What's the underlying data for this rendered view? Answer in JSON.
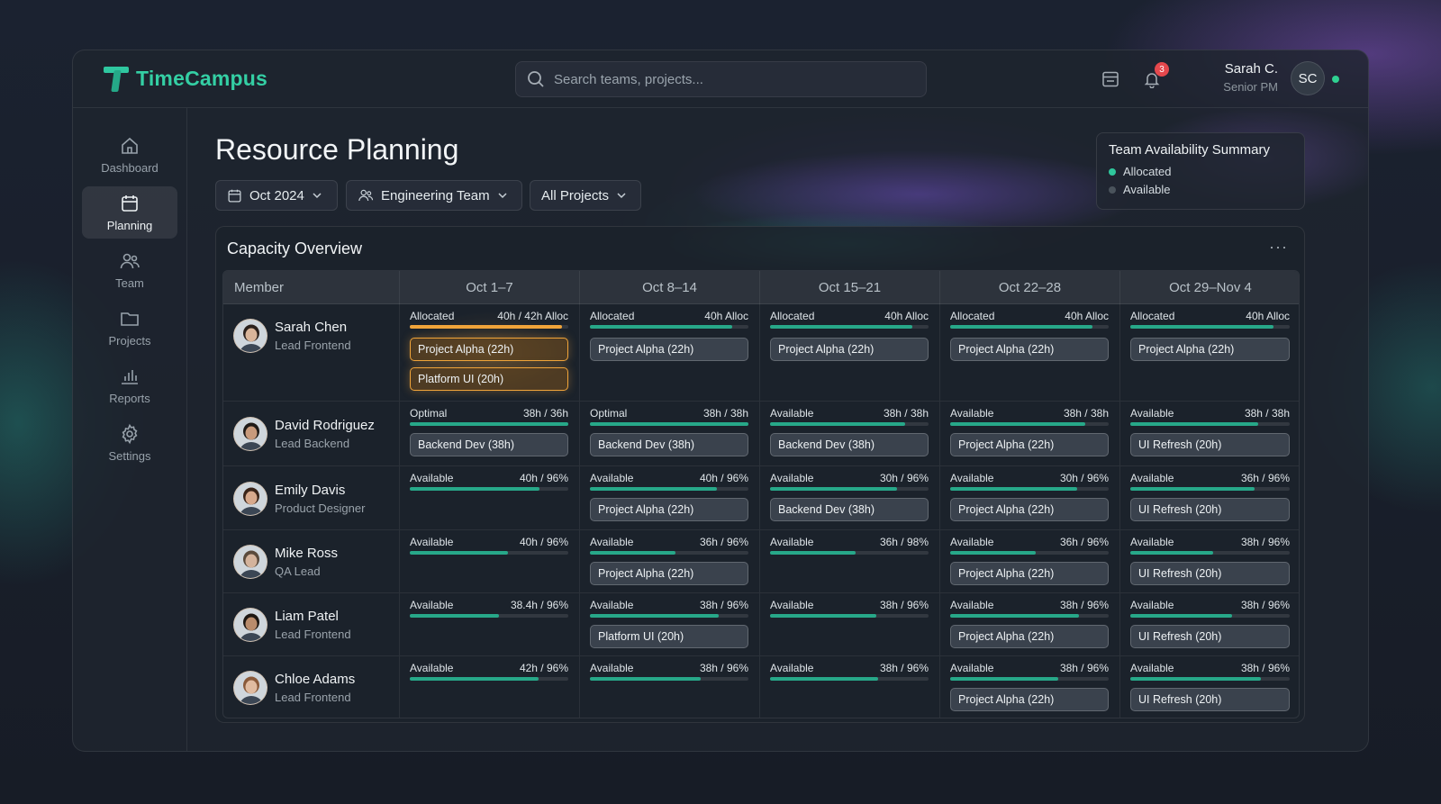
{
  "app": {
    "name": "TimeCampus"
  },
  "search": {
    "placeholder": "Search teams, projects..."
  },
  "header": {
    "notifications_count": "3",
    "user_name": "Sarah C.",
    "user_role": "Senior PM",
    "user_initials": "SC"
  },
  "sidebar": {
    "items": [
      {
        "label": "Dashboard",
        "icon": "home-icon"
      },
      {
        "label": "Planning",
        "icon": "calendar-icon",
        "active": true
      },
      {
        "label": "Team",
        "icon": "users-icon"
      },
      {
        "label": "Projects",
        "icon": "folder-icon"
      },
      {
        "label": "Reports",
        "icon": "bar-chart-icon"
      },
      {
        "label": "Settings",
        "icon": "gear-icon"
      }
    ]
  },
  "page": {
    "title": "Resource Planning"
  },
  "filters": {
    "month": "Oct 2024",
    "team": "Engineering Team",
    "projects": "All Projects"
  },
  "summary": {
    "title": "Team Availability Summary",
    "allocated_label": "Allocated",
    "available_label": "Available",
    "allocated_color": "#2fc79c",
    "available_color": "#4a535c"
  },
  "capacity": {
    "title": "Capacity Overview",
    "more": "···",
    "member_header": "Member",
    "weeks": [
      "Oct 1–7",
      "Oct 8–14",
      "Oct 15–21",
      "Oct 22–28",
      "Oct 29–Nov 4"
    ],
    "rows": [
      {
        "name": "Sarah Chen",
        "role": "Lead Frontend",
        "cells": [
          {
            "status": "Allocated",
            "hours": "40h / 42h Alloc",
            "fill": 0.96,
            "over": true,
            "chips": [
              "Project Alpha (22h)",
              "Platform UI (20h)"
            ]
          },
          {
            "status": "Allocated",
            "hours": "40h Alloc",
            "fill": 0.9,
            "chips": [
              "Project Alpha (22h)"
            ]
          },
          {
            "status": "Allocated",
            "hours": "40h Alloc",
            "fill": 0.9,
            "chips": [
              "Project Alpha (22h)"
            ]
          },
          {
            "status": "Allocated",
            "hours": "40h Alloc",
            "fill": 0.9,
            "chips": [
              "Project Alpha (22h)"
            ]
          },
          {
            "status": "Allocated",
            "hours": "40h Alloc",
            "fill": 0.9,
            "chips": [
              "Project Alpha (22h)"
            ]
          }
        ]
      },
      {
        "name": "David Rodriguez",
        "role": "Lead Backend",
        "cells": [
          {
            "status": "Optimal",
            "hours": "38h / 36h",
            "fill": 1.0,
            "chips": [
              "Backend Dev (38h)"
            ]
          },
          {
            "status": "Optimal",
            "hours": "38h / 38h",
            "fill": 1.0,
            "chips": [
              "Backend Dev (38h)"
            ]
          },
          {
            "status": "Available",
            "hours": "38h / 38h",
            "fill": 0.85,
            "chips": [
              "Backend Dev (38h)"
            ]
          },
          {
            "status": "Available",
            "hours": "38h / 38h",
            "fill": 0.85,
            "chips": [
              "Project Alpha (22h)"
            ]
          },
          {
            "status": "Available",
            "hours": "38h / 38h",
            "fill": 0.8,
            "chips": [
              "UI Refresh (20h)"
            ]
          }
        ]
      },
      {
        "name": "Emily Davis",
        "role": "Product Designer",
        "cells": [
          {
            "status": "Available",
            "hours": "40h / 96%",
            "fill": 0.82,
            "chips": []
          },
          {
            "status": "Available",
            "hours": "40h / 96%",
            "fill": 0.8,
            "chips": [
              "Project Alpha (22h)"
            ]
          },
          {
            "status": "Available",
            "hours": "30h / 96%",
            "fill": 0.8,
            "chips": [
              "Backend Dev (38h)"
            ]
          },
          {
            "status": "Available",
            "hours": "30h / 96%",
            "fill": 0.8,
            "chips": [
              "Project Alpha (22h)"
            ]
          },
          {
            "status": "Available",
            "hours": "36h / 96%",
            "fill": 0.78,
            "chips": [
              "UI Refresh (20h)"
            ]
          }
        ]
      },
      {
        "name": "Mike Ross",
        "role": "QA Lead",
        "cells": [
          {
            "status": "Available",
            "hours": "40h / 96%",
            "fill": 0.62,
            "chips": []
          },
          {
            "status": "Available",
            "hours": "36h / 96%",
            "fill": 0.54,
            "chips": [
              "Project Alpha (22h)"
            ]
          },
          {
            "status": "Available",
            "hours": "36h / 98%",
            "fill": 0.54,
            "chips": []
          },
          {
            "status": "Available",
            "hours": "36h / 96%",
            "fill": 0.54,
            "chips": [
              "Project Alpha (22h)"
            ]
          },
          {
            "status": "Available",
            "hours": "38h / 96%",
            "fill": 0.52,
            "chips": [
              "UI Refresh (20h)"
            ]
          }
        ]
      },
      {
        "name": "Liam Patel",
        "role": "Lead Frontend",
        "cells": [
          {
            "status": "Available",
            "hours": "38.4h / 96%",
            "fill": 0.56,
            "chips": []
          },
          {
            "status": "Available",
            "hours": "38h / 96%",
            "fill": 0.81,
            "chips": [
              "Platform UI (20h)"
            ]
          },
          {
            "status": "Available",
            "hours": "38h / 96%",
            "fill": 0.67,
            "chips": []
          },
          {
            "status": "Available",
            "hours": "38h / 96%",
            "fill": 0.81,
            "chips": [
              "Project Alpha (22h)"
            ]
          },
          {
            "status": "Available",
            "hours": "38h / 96%",
            "fill": 0.64,
            "chips": [
              "UI Refresh (20h)"
            ]
          }
        ]
      },
      {
        "name": "Chloe Adams",
        "role": "Lead Frontend",
        "cells": [
          {
            "status": "Available",
            "hours": "42h / 96%",
            "fill": 0.81,
            "chips": []
          },
          {
            "status": "Available",
            "hours": "38h / 96%",
            "fill": 0.7,
            "chips": []
          },
          {
            "status": "Available",
            "hours": "38h / 96%",
            "fill": 0.68,
            "chips": []
          },
          {
            "status": "Available",
            "hours": "38h / 96%",
            "fill": 0.68,
            "chips": [
              "Project Alpha (22h)"
            ]
          },
          {
            "status": "Available",
            "hours": "38h / 96%",
            "fill": 0.82,
            "chips": [
              "UI Refresh (20h)"
            ]
          }
        ]
      }
    ]
  }
}
